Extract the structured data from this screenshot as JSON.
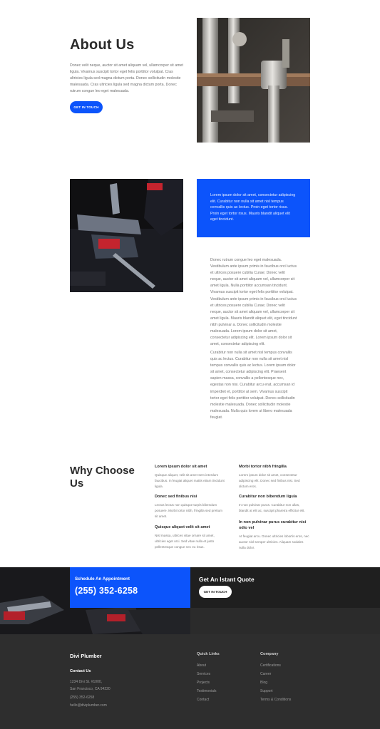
{
  "about": {
    "title": "About Us",
    "text": "Donec velit neque, auctor sit amet aliquam vel, ullamcorper sit amet ligula. Vivamus suscipit tortor eget felis porttitor volutpat. Cras ultricies ligula sed magna dictum porta. Donec sollicitudin molestie malesuada. Cras ultricies ligula sed magna dictum porta. Donec rutrum congue leo eget malesuada.",
    "button": "GET IN TOUCH"
  },
  "blue_box": {
    "text": "Lorem ipsum dolor sit amet, consectetur adipiscing elit. Curabitur non nulla sit amet nisl tempus convallis quis ac lectus. Proin eget tortor risus. Proin eget tortor risus. Mauris blandit aliquet elit eget tincidunt."
  },
  "body": {
    "p1": "Donec rutrum congue leo eget malesuada. Vestibulum ante ipsum primis in faucibus orci luctus et ultrices posuere cubilia Curae; Donec velit neque, auctor sit amet aliquam vel, ullamcorper sit amet ligula. Nulla porttitor accumsan tincidunt. Vivamus suscipit tortor eget felis porttitor volutpat. Vestibulum ante ipsum primis in faucibus orci luctus et ultrices posuere cubilia Curae; Donec velit neque, auctor sit amet aliquam vel, ullamcorper sit amet ligula. Mauris blandit aliquet elit, eget tincidunt nibh pulvinar a. Donec sollicitudin molestie malesuada. Lorem ipsum dolor sit amet, consectetur adipiscing elit. Lorem ipsum dolor sit amet, consectetur adipiscing elit.",
    "p2": "Curabitur non nulla sit amet nisl tempus convallis quis ac lectus. Curabitur non nulla sit amet nisl tempus convallis quis ac lectus. Lorem ipsum dolor sit amet, consectetur adipiscing elit. Praesent sapien massa, convallis a pellentesque nec, egestas non nisi. Curabitur arcu erat, accumsan id imperdiet et, porttitor at sem. Vivamus suscipit tortor eget felis porttitor volutpat. Donec sollicitudin molestie malesuada. Donec sollicitudin molestie malesuada. Nulla quis lorem ut libero malesuada feugiat."
  },
  "why": {
    "title": "Why Choose Us",
    "features": [
      {
        "title": "Lorem ipsum dolor sit amet",
        "text": "Quisque aliquet, velit sit amet sem interdum faucibus. In feugiat aliquet mattis etiam tincidunt ligula."
      },
      {
        "title": "Morbi tortor nibh fringilla",
        "text": "Lorem ipsum dolor sit amet, consectetur adipiscing elit. Donec sed finibus nisi. Sed dictum eros."
      },
      {
        "title": "Donec sed finibus nisi",
        "text": "Lectus lectus non quisque turpis bibendum posuere. Morbi tortor nibh, fringilla sed pretium sit amet."
      },
      {
        "title": "Curabitur non bibendum ligula",
        "text": "In non pulvinar purus. Curabitur non ullas, blandit at elit ac, suscipit pharetra efficitur elit."
      },
      {
        "title": "Quisque aliquet velit sit amet",
        "text": "Nisl massa, ultrices vitae ornare sit amet, ultricies eget orci. Sed vitae nulla et justo pellentesque congue nec eu risus."
      },
      {
        "title": "In non pulvinar purus curabitur nisi odio vel",
        "text": "At feugiat arcu. Donec ultricies lobortis eros, nec auctor nisl semper ultricies. Aliquam sodales nulla dolor."
      }
    ]
  },
  "cta": {
    "schedule_label": "Schedule An Appointment",
    "phone": "(255) 352-6258",
    "quote_title": "Get An Istant Quote",
    "quote_button": "GET IN TOUCH"
  },
  "footer": {
    "brand": "Divi Plumber",
    "contact_heading": "Contact Us",
    "address1": "1234 Divi St. #1000,",
    "address2": "San Francisco, CA 94220",
    "phone": "(255) 352-6258",
    "email": "hello@diviplumber.com",
    "quick_links_heading": "Quick Links",
    "quick_links": [
      "About",
      "Services",
      "Projects",
      "Testimonials",
      "Contact"
    ],
    "company_heading": "Company",
    "company_links": [
      "Certifications",
      "Career",
      "Blog",
      "Support",
      "Terms & Conditions"
    ]
  },
  "colors": {
    "accent": "#0c54fb",
    "dark": "#2e2e2e",
    "text": "#2a2a2a"
  }
}
